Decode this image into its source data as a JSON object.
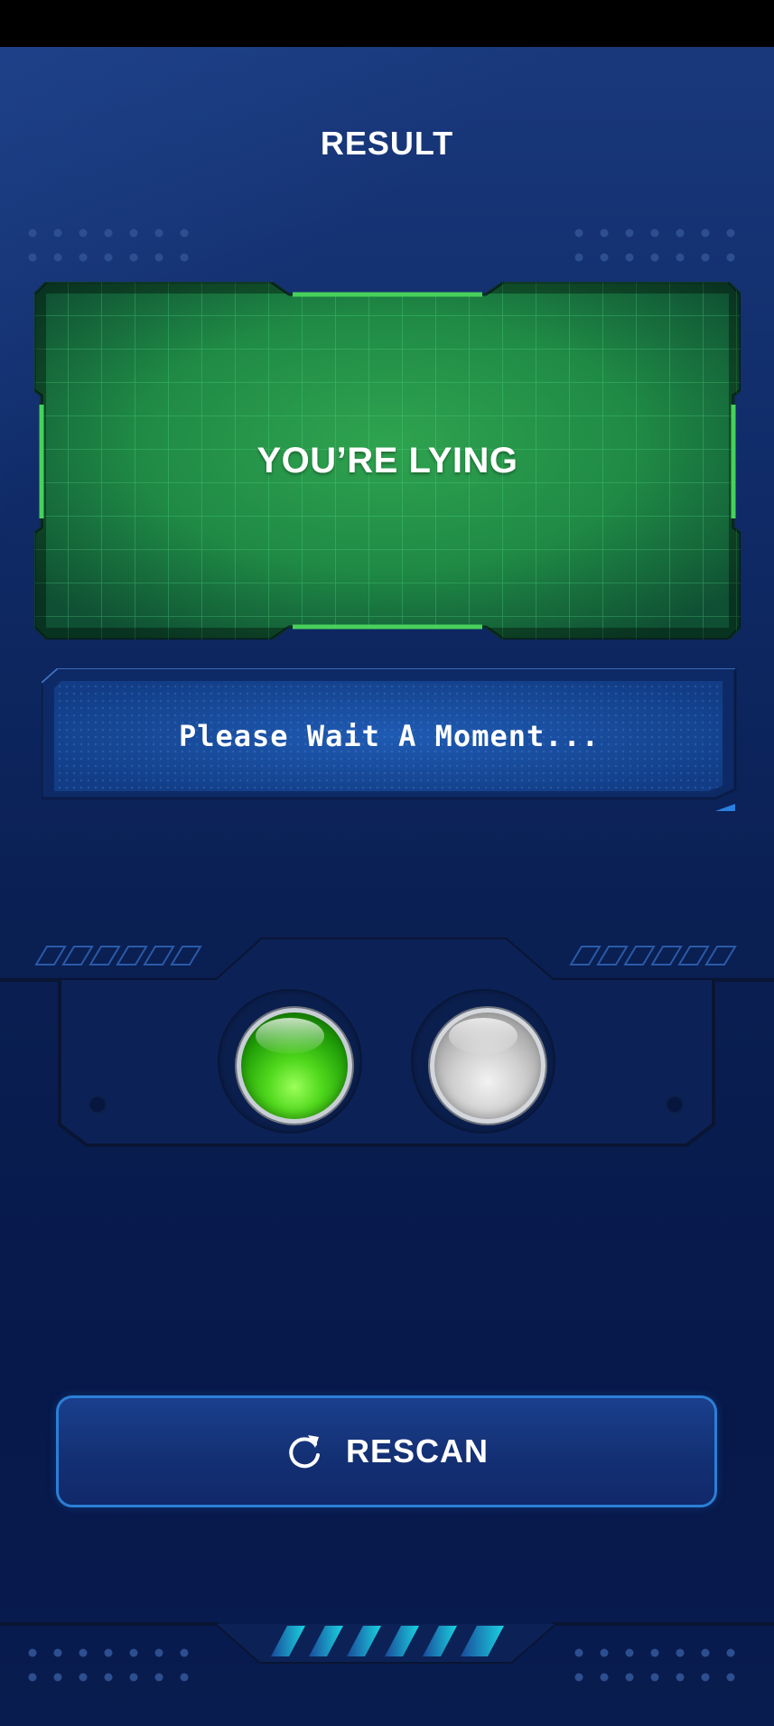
{
  "header": {
    "title": "RESULT"
  },
  "result": {
    "verdict": "YOU’RE LYING"
  },
  "status": {
    "message": "Please Wait A Moment..."
  },
  "indicators": [
    {
      "name": "lie-light",
      "state": "on",
      "color": "#3fcc12"
    },
    {
      "name": "truth-light",
      "state": "off",
      "color": "#bdbdbd"
    }
  ],
  "actions": {
    "rescan_label": "RESCAN"
  },
  "colors": {
    "background": "#0f2a66",
    "accent_green": "#3fcc3f",
    "accent_blue": "#2b7fd6",
    "footer_stripes": "#18c6d8"
  }
}
